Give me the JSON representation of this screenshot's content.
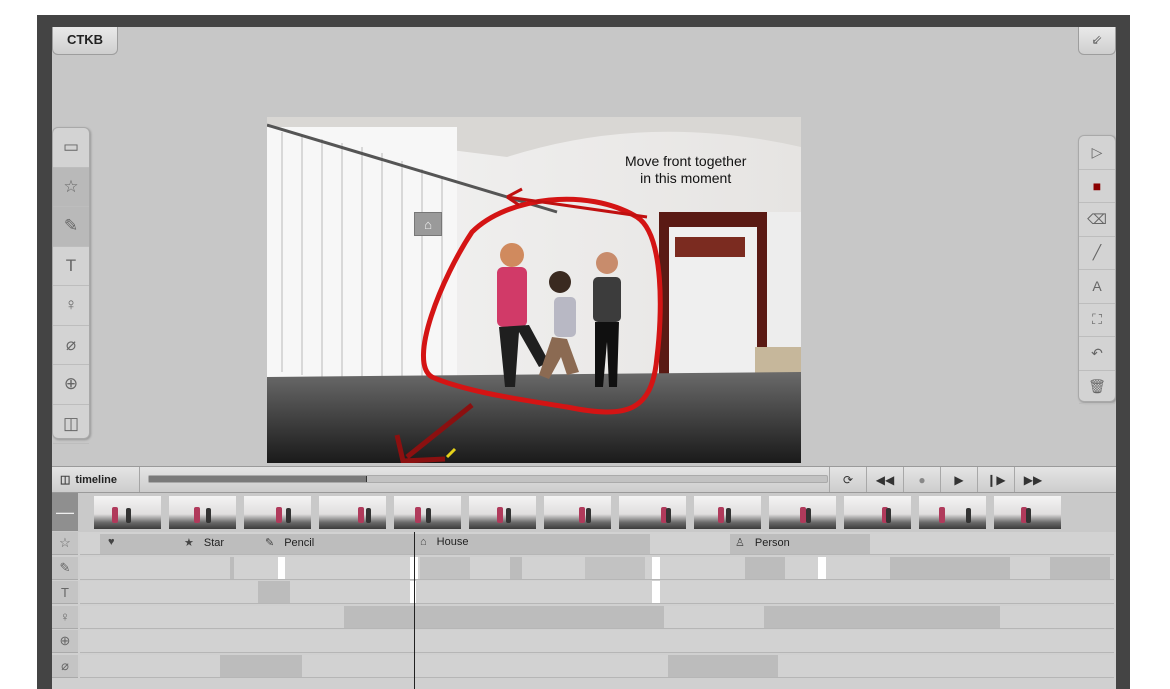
{
  "app": {
    "brand": "CTKB",
    "collapse_icon": "collapse-arrow-icon"
  },
  "left_tools": [
    {
      "name": "screen-icon",
      "glyph": "▭",
      "active": false
    },
    {
      "name": "star-icon",
      "glyph": "☆",
      "active": true
    },
    {
      "name": "pencil-icon",
      "glyph": "✎",
      "active": true
    },
    {
      "name": "text-icon",
      "glyph": "T",
      "active": false
    },
    {
      "name": "microphone-icon",
      "glyph": "♀",
      "active": false
    },
    {
      "name": "no-link-icon",
      "glyph": "⌀",
      "active": false
    },
    {
      "name": "target-icon",
      "glyph": "⊕",
      "active": false
    },
    {
      "name": "camera-icon",
      "glyph": "◫",
      "active": false
    }
  ],
  "right_tools": [
    {
      "name": "cursor-icon",
      "glyph": "▷"
    },
    {
      "name": "color-swatch-icon",
      "glyph": "■",
      "color": "#8b0000"
    },
    {
      "name": "eraser-icon",
      "glyph": "⌫"
    },
    {
      "name": "line-icon",
      "glyph": "╱"
    },
    {
      "name": "text-box-icon",
      "glyph": "A"
    },
    {
      "name": "person-frame-icon",
      "glyph": "⛶"
    },
    {
      "name": "undo-icon",
      "glyph": "↶"
    },
    {
      "name": "trash-icon",
      "glyph": "🗑"
    }
  ],
  "video": {
    "annotation_text_line1": "Move front together",
    "annotation_text_line2": "in this moment",
    "annotation_color": "#d41414",
    "arrow_color": "#8b1010"
  },
  "timeline": {
    "label": "timeline",
    "progress": 0.32,
    "controls": [
      {
        "name": "loop-icon",
        "glyph": "⟳"
      },
      {
        "name": "rewind-icon",
        "glyph": "◀◀"
      },
      {
        "name": "record-icon",
        "glyph": "●"
      },
      {
        "name": "play-icon",
        "glyph": "▶"
      },
      {
        "name": "step-forward-icon",
        "glyph": "❙▶"
      },
      {
        "name": "fast-forward-icon",
        "glyph": "▶▶"
      }
    ],
    "markers": [
      {
        "icon": "heart-icon",
        "glyph": "♥",
        "label": ""
      },
      {
        "icon": "star-icon",
        "glyph": "★",
        "label": "Star"
      },
      {
        "icon": "pencil-icon",
        "glyph": "✎",
        "label": "Pencil"
      },
      {
        "icon": "house-icon",
        "glyph": "⌂",
        "label": "House"
      },
      {
        "icon": "person-icon",
        "glyph": "♙",
        "label": "Person"
      }
    ],
    "row_icons": [
      "star-icon",
      "pencil-icon",
      "text-icon",
      "microphone-icon",
      "target-icon",
      "no-link-icon"
    ],
    "row_glyphs": [
      "☆",
      "✎",
      "T",
      "♀",
      "⊕",
      "⌀"
    ]
  }
}
